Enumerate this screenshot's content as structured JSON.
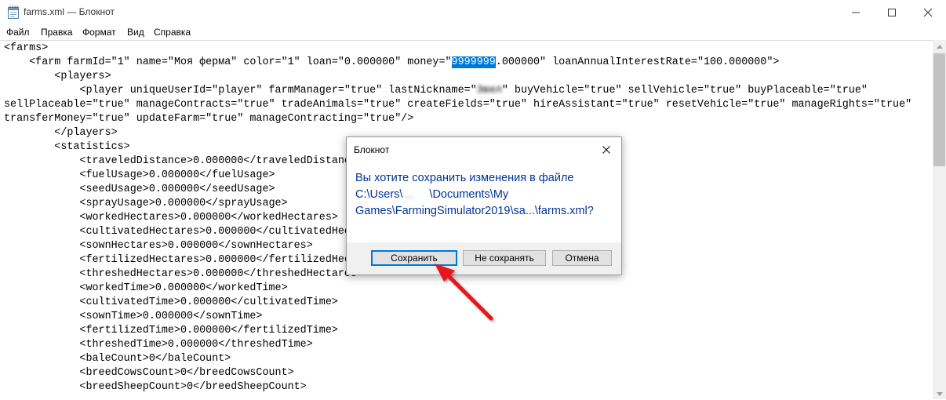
{
  "window": {
    "title": "farms.xml — Блокнот",
    "minimize_icon": "minimize-icon",
    "maximize_icon": "maximize-icon",
    "close_icon": "close-icon"
  },
  "menu": [
    "Файл",
    "Правка",
    "Формат",
    "Вид",
    "Справка"
  ],
  "editor": {
    "lines": [
      {
        "text": "<farms>"
      },
      {
        "text": "    <farm farmId=\"1\" name=\"Моя ферма\" color=\"1\" loan=\"0.000000\" money=\"",
        "sel": "9999999",
        "after": ".000000\" loanAnnualInterestRate=\"100.000000\">"
      },
      {
        "text": "        <players>"
      },
      {
        "text": "            <player uniqueUserId=\"player\" farmManager=\"true\" lastNickname=\"",
        "blur": "Эвел",
        "after": "\" buyVehicle=\"true\" sellVehicle=\"true\" buyPlaceable=\"true\""
      },
      {
        "text": "sellPlaceable=\"true\" manageContracts=\"true\" tradeAnimals=\"true\" createFields=\"true\" hireAssistant=\"true\" resetVehicle=\"true\" manageRights=\"true\""
      },
      {
        "text": "transferMoney=\"true\" updateFarm=\"true\" manageContracting=\"true\"/>"
      },
      {
        "text": "        </players>"
      },
      {
        "text": "        <statistics>"
      },
      {
        "text": "            <traveledDistance>0.000000</traveledDistance>"
      },
      {
        "text": "            <fuelUsage>0.000000</fuelUsage>"
      },
      {
        "text": "            <seedUsage>0.000000</seedUsage>"
      },
      {
        "text": "            <sprayUsage>0.000000</sprayUsage>"
      },
      {
        "text": "            <workedHectares>0.000000</workedHectares>"
      },
      {
        "text": "            <cultivatedHectares>0.000000</cultivatedHectares>"
      },
      {
        "text": "            <sownHectares>0.000000</sownHectares>"
      },
      {
        "text": "            <fertilizedHectares>0.000000</fertilizedHectares>"
      },
      {
        "text": "            <threshedHectares>0.000000</threshedHectares>"
      },
      {
        "text": "            <workedTime>0.000000</workedTime>"
      },
      {
        "text": "            <cultivatedTime>0.000000</cultivatedTime>"
      },
      {
        "text": "            <sownTime>0.000000</sownTime>"
      },
      {
        "text": "            <fertilizedTime>0.000000</fertilizedTime>"
      },
      {
        "text": "            <threshedTime>0.000000</threshedTime>"
      },
      {
        "text": "            <baleCount>0</baleCount>"
      },
      {
        "text": "            <breedCowsCount>0</breedCowsCount>"
      },
      {
        "text": "            <breedSheepCount>0</breedSheepCount>"
      }
    ]
  },
  "dialog": {
    "title": "Блокнот",
    "message_line1": "Вы хотите сохранить изменения в файле",
    "message_path_start": "C:\\Users\\",
    "message_path_blur": "…",
    "message_path_end": "\\Documents\\My",
    "message_line3": "Games\\FarmingSimulator2019\\sa...\\farms.xml?",
    "buttons": {
      "save": "Сохранить",
      "dont_save": "Не сохранять",
      "cancel": "Отмена"
    }
  },
  "annotation": {
    "arrow_color": "#e8141b"
  }
}
